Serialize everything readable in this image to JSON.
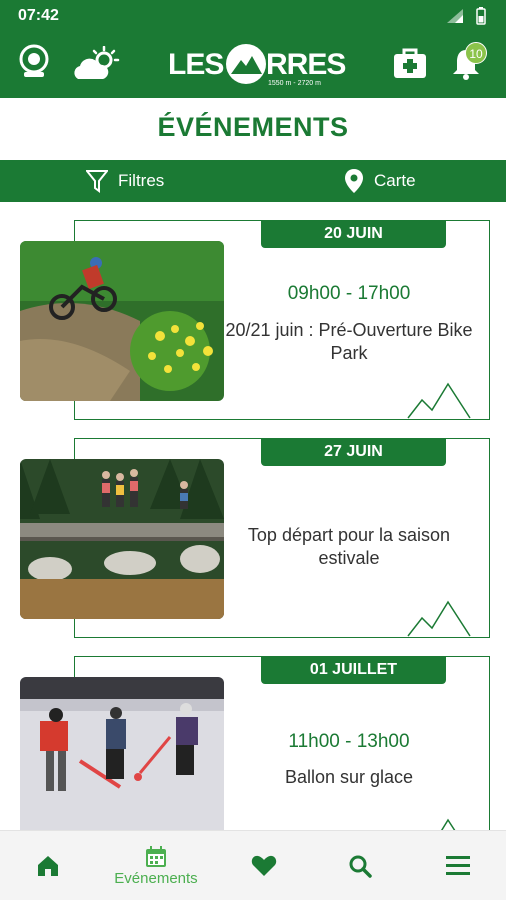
{
  "status_bar": {
    "time": "07:42"
  },
  "header": {
    "logo_les": "LES",
    "logo_rres": "RRES",
    "logo_altitude": "1550 m - 2720 m",
    "notification_count": "10",
    "color": "#1b7a34"
  },
  "page": {
    "title": "ÉVÉNEMENTS"
  },
  "filters": {
    "filter_label": "Filtres",
    "map_label": "Carte"
  },
  "events": [
    {
      "date": "20 JUIN",
      "time": "09h00 - 17h00",
      "title": "20/21 juin : Pré-Ouverture Bike Park"
    },
    {
      "date": "27 JUIN",
      "time": "",
      "title": "Top départ pour la saison estivale"
    },
    {
      "date": "01 JUILLET",
      "time": "11h00 - 13h00",
      "title": "Ballon sur glace"
    }
  ],
  "bottom_nav": {
    "items": [
      {
        "icon": "home-icon",
        "label": ""
      },
      {
        "icon": "calendar-icon",
        "label": "Evénements"
      },
      {
        "icon": "heart-icon",
        "label": ""
      },
      {
        "icon": "search-icon",
        "label": ""
      },
      {
        "icon": "menu-icon",
        "label": ""
      }
    ]
  }
}
